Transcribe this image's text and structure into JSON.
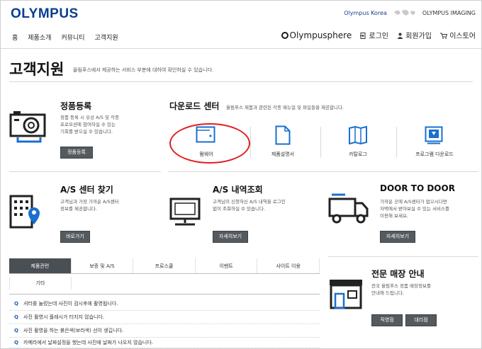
{
  "header": {
    "logo": "OLYMPUS",
    "korea_link": "Olympus Korea",
    "imaging_link": "OLYMPUS IMAGING",
    "nav": [
      "홈",
      "제품소개",
      "커뮤니티",
      "고객지원"
    ],
    "sphere": "Olympusphere",
    "login": "로그인",
    "join": "회원가입",
    "store": "이스토어"
  },
  "page": {
    "title": "고객지원",
    "subtitle": "올림푸스에서 제공하는 서비스 부분에 대하여 확인하실 수 있습니다."
  },
  "product_reg": {
    "title": "정품등록",
    "desc1": "정품 등록 시 유상 A/S 및 각종",
    "desc2": "프로모션에 참여하실 수 있는",
    "desc3": "기회를 받으실 수 있습니다.",
    "button": "정품등록"
  },
  "download_center": {
    "title": "다운로드 센터",
    "subtitle": "올림푸스 제품과 관련된 각종 매뉴얼 및 파일들을 제공합니다.",
    "items": [
      "펌웨어",
      "제품설명서",
      "카탈로그",
      "프로그램 다운로드"
    ]
  },
  "as_center": {
    "title": "A/S 센터 찾기",
    "desc1": "고객님과 가장 가까운 A/S센터",
    "desc2": "정보를 제공합니다.",
    "button": "바로가기"
  },
  "as_history": {
    "title": "A/S 내역조회",
    "desc1": "고객님이 신청하신 A/S 내역을 로그인",
    "desc2": "없이 조회하실 수 있습니다.",
    "button": "자세히보기"
  },
  "door": {
    "title": "DOOR TO DOOR",
    "desc1": "가까운 곳에 A/S센터가 없으시다면",
    "desc2": "자택에서 받아보실 수 있는 서비스를",
    "desc3": "이용해 보세요.",
    "button": "자세히보기"
  },
  "faq": {
    "tabs": [
      "제품관련",
      "보증 및 A/S",
      "프로스쿨",
      "이벤트",
      "사이트 이용"
    ],
    "tab_extra": "기타",
    "items": [
      "셔터를 눌렀는데 사진이 검시후에 촬영됩니다.",
      "사진 촬영시 플래시가 터지지 않습니다.",
      "사진 촬영을 하는 붉은색(보라색) 선이 생깁니다.",
      "카메라에서 날짜설정을 했는데 사진에 날짜가 나오지 않습니다."
    ]
  },
  "shop": {
    "title": "전문 매장 안내",
    "desc1": "전국 올림푸스 정품 매장정보를",
    "desc2": "안내해 드립니다.",
    "btn1": "직영점",
    "btn2": "대리점"
  },
  "colors": {
    "brand": "#0a3d8f",
    "icon_blue": "#1a6fd0",
    "annotation": "#e02020",
    "button": "#555a5f"
  }
}
